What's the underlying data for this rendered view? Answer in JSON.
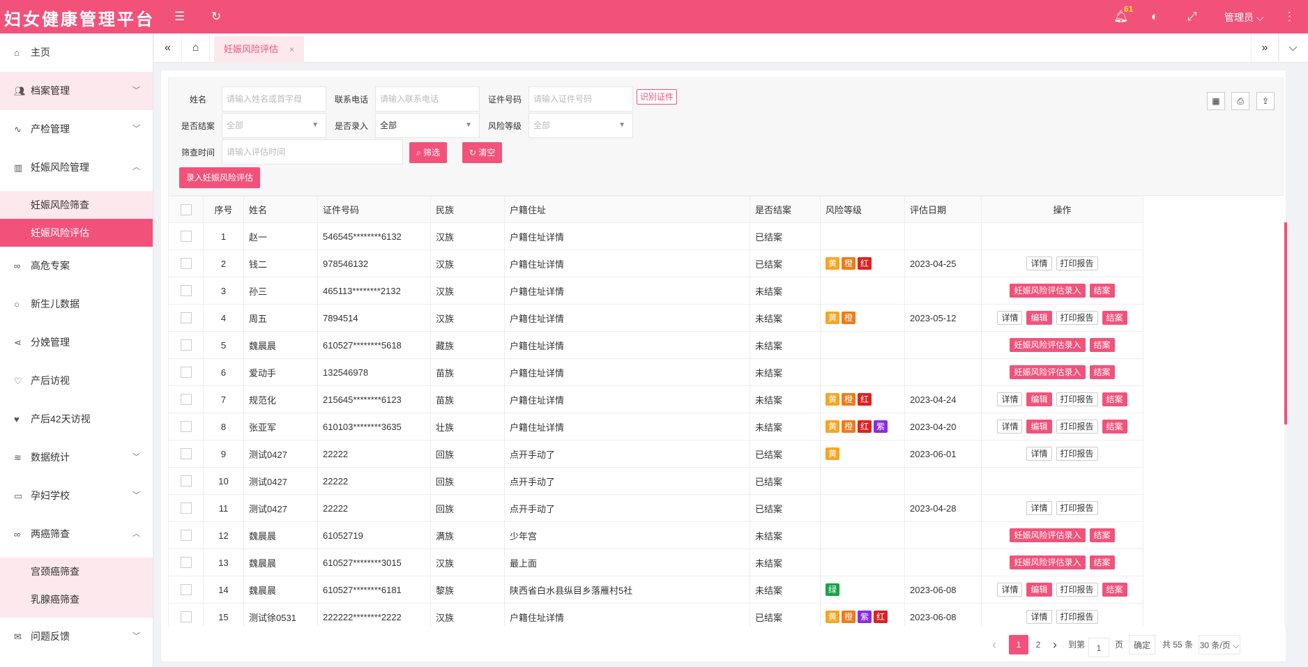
{
  "header": {
    "title": "妇女健康管理平台",
    "badge_count": "61",
    "user": "管理员"
  },
  "sidebar": {
    "items": [
      {
        "label": "主页",
        "icon": "home-icon"
      },
      {
        "label": "档案管理",
        "icon": "users-icon"
      },
      {
        "label": "产检管理",
        "icon": "pulse-icon"
      },
      {
        "label": "妊娠风险管理",
        "icon": "table-icon"
      },
      {
        "label": "妊娠风险筛查"
      },
      {
        "label": "妊娠风险评估"
      },
      {
        "label": "高危专案",
        "icon": "link-icon"
      },
      {
        "label": "新生儿数据",
        "icon": "circle-icon"
      },
      {
        "label": "分娩管理",
        "icon": "share-icon"
      },
      {
        "label": "产后访视",
        "icon": "heart-outline-icon"
      },
      {
        "label": "产后42天访视",
        "icon": "heart-icon"
      },
      {
        "label": "数据统计",
        "icon": "layers-icon"
      },
      {
        "label": "孕妇学校",
        "icon": "book-icon"
      },
      {
        "label": "两癌筛查",
        "icon": "link-icon"
      },
      {
        "label": "宫颈癌筛查"
      },
      {
        "label": "乳腺癌筛查"
      },
      {
        "label": "问题反馈",
        "icon": "mail-icon"
      }
    ]
  },
  "tabs": {
    "active": "妊娠风险评估",
    "close": "×"
  },
  "filters": {
    "name_label": "姓名",
    "name_placeholder": "请输入姓名或首字母",
    "phone_label": "联系电话",
    "phone_placeholder": "请输入联系电话",
    "id_label": "证件号码",
    "id_placeholder": "请输入证件号码",
    "id_read_btn": "识别证件",
    "closed_label": "是否结案",
    "closed_value": "全部",
    "entered_label": "是否录入",
    "entered_value": "全部",
    "risk_label": "风险等级",
    "risk_value": "全部",
    "time_label": "筛查时间",
    "time_placeholder": "请输入评估时间",
    "search_btn": "筛选",
    "clear_btn": "清空",
    "add_btn": "录入妊娠风险评估"
  },
  "table": {
    "headers": [
      "序号",
      "姓名",
      "证件号码",
      "民族",
      "户籍住址",
      "是否结案",
      "风险等级",
      "评估日期",
      "操作"
    ],
    "rows": [
      {
        "no": "1",
        "name": "赵一",
        "id": "546545********6132",
        "nation": "汉族",
        "addr": "户籍住址详情",
        "closed": "已结案",
        "risks": [],
        "date": "",
        "ops": []
      },
      {
        "no": "2",
        "name": "钱二",
        "id": "978546132",
        "nation": "汉族",
        "addr": "户籍住址详情",
        "closed": "已结案",
        "risks": [
          "黄",
          "橙",
          "红"
        ],
        "date": "2023-04-25",
        "ops": [
          "详情",
          "打印报告"
        ]
      },
      {
        "no": "3",
        "name": "孙三",
        "id": "465113********2132",
        "nation": "汉族",
        "addr": "户籍住址详情",
        "closed": "未结案",
        "risks": [],
        "date": "",
        "ops": [
          "妊娠风险评估录入",
          "结案"
        ]
      },
      {
        "no": "4",
        "name": "周五",
        "id": "7894514",
        "nation": "汉族",
        "addr": "户籍住址详情",
        "closed": "未结案",
        "risks": [
          "黄",
          "橙"
        ],
        "date": "2023-05-12",
        "ops": [
          "详情",
          "编辑",
          "打印报告",
          "结案"
        ]
      },
      {
        "no": "5",
        "name": "魏晨晨",
        "id": "610527********5618",
        "nation": "藏族",
        "addr": "户籍住址详情",
        "closed": "未结案",
        "risks": [],
        "date": "",
        "ops": [
          "妊娠风险评估录入",
          "结案"
        ]
      },
      {
        "no": "6",
        "name": "爱动手",
        "id": "132546978",
        "nation": "苗族",
        "addr": "户籍住址详情",
        "closed": "未结案",
        "risks": [],
        "date": "",
        "ops": [
          "妊娠风险评估录入",
          "结案"
        ]
      },
      {
        "no": "7",
        "name": "规范化",
        "id": "215645********6123",
        "nation": "苗族",
        "addr": "户籍住址详情",
        "closed": "未结案",
        "risks": [
          "黄",
          "橙",
          "红"
        ],
        "date": "2023-04-24",
        "ops": [
          "详情",
          "编辑",
          "打印报告",
          "结案"
        ]
      },
      {
        "no": "8",
        "name": "张亚军",
        "id": "610103********3635",
        "nation": "壮族",
        "addr": "户籍住址详情",
        "closed": "未结案",
        "risks": [
          "黄",
          "橙",
          "红",
          "紫"
        ],
        "date": "2023-04-20",
        "ops": [
          "详情",
          "编辑",
          "打印报告",
          "结案"
        ]
      },
      {
        "no": "9",
        "name": "测试0427",
        "id": "22222",
        "nation": "回族",
        "addr": "点开手动了",
        "closed": "已结案",
        "risks": [
          "黄"
        ],
        "date": "2023-06-01",
        "ops": [
          "详情",
          "打印报告"
        ]
      },
      {
        "no": "10",
        "name": "测试0427",
        "id": "22222",
        "nation": "回族",
        "addr": "点开手动了",
        "closed": "已结案",
        "risks": [],
        "date": "",
        "ops": []
      },
      {
        "no": "11",
        "name": "测试0427",
        "id": "22222",
        "nation": "回族",
        "addr": "点开手动了",
        "closed": "已结案",
        "risks": [],
        "date": "2023-04-28",
        "ops": [
          "详情",
          "打印报告"
        ]
      },
      {
        "no": "12",
        "name": "魏晨晨",
        "id": "61052719",
        "nation": "满族",
        "addr": "少年宫",
        "closed": "未结案",
        "risks": [],
        "date": "",
        "ops": [
          "妊娠风险评估录入",
          "结案"
        ]
      },
      {
        "no": "13",
        "name": "魏晨晨",
        "id": "610527********3015",
        "nation": "汉族",
        "addr": "最上面",
        "closed": "未结案",
        "risks": [],
        "date": "",
        "ops": [
          "妊娠风险评估录入",
          "结案"
        ]
      },
      {
        "no": "14",
        "name": "魏晨晨",
        "id": "610527********6181",
        "nation": "黎族",
        "addr": "陕西省白水县纵目乡落雁村5社",
        "closed": "未结案",
        "risks": [
          "绿"
        ],
        "date": "2023-06-08",
        "ops": [
          "详情",
          "编辑",
          "打印报告",
          "结案"
        ]
      },
      {
        "no": "15",
        "name": "测试徐0531",
        "id": "222222********2222",
        "nation": "汉族",
        "addr": "户籍住址详情",
        "closed": "已结案",
        "risks": [
          "黄",
          "橙",
          "紫",
          "红"
        ],
        "date": "2023-06-08",
        "ops": [
          "详情",
          "打印报告"
        ]
      }
    ]
  },
  "risk_colors": {
    "黄": "#f5a623",
    "橙": "#f07a1a",
    "红": "#e02020",
    "紫": "#8a2be2",
    "绿": "#1aa34a"
  },
  "pagination": {
    "prev": "‹",
    "page1": "1",
    "page2": "2",
    "next": "›",
    "goto_label": "到第",
    "goto_value": "1",
    "page_unit": "页",
    "confirm": "确定",
    "total": "共 55 条",
    "per_page": "30 条/页"
  }
}
